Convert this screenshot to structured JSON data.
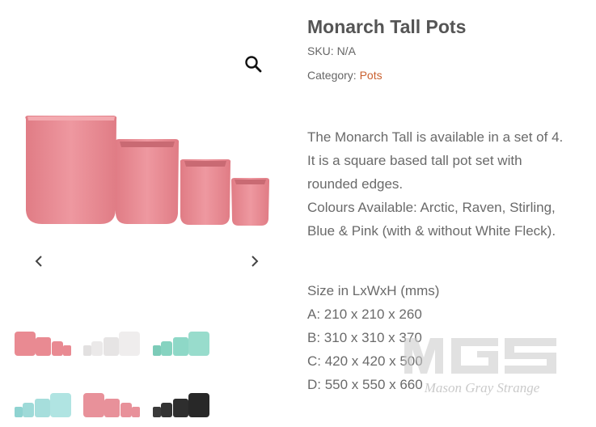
{
  "product": {
    "title": "Monarch Tall Pots",
    "sku": "SKU: N/A",
    "category_label": "Category: ",
    "category_link": "Pots",
    "description": [
      "The Monarch Tall is available in a set of 4. It is a square based tall pot set with rounded edges.",
      "Colours Available: Arctic, Raven, Stirling, Blue & Pink (with & without White Fleck)."
    ],
    "size_heading": "Size in LxWxH (mms)",
    "sizes": [
      "A: 210 x 210 x 260",
      "B: 310 x 310 x 370",
      "C: 420 x 420 x 500",
      "D: 550 x 550 x 660"
    ]
  },
  "gallery": {
    "zoom_icon": "magnifier-icon",
    "prev_icon": "chevron-left-icon",
    "next_icon": "chevron-right-icon",
    "thumbnails": [
      {
        "color": "pink",
        "hex": "#e98a92"
      },
      {
        "color": "white",
        "hex": "#e8e6e6"
      },
      {
        "color": "mint",
        "hex": "#8ed8c7"
      },
      {
        "color": "light-blue",
        "hex": "#9edad8"
      },
      {
        "color": "pink-fleck",
        "hex": "#e8919a"
      },
      {
        "color": "black",
        "hex": "#2e2e2e"
      }
    ]
  },
  "watermark": {
    "logo": "MGS",
    "text": "Mason Gray Strange"
  },
  "colors": {
    "accent_link": "#c9602f",
    "pot_main": "#e98a92"
  }
}
